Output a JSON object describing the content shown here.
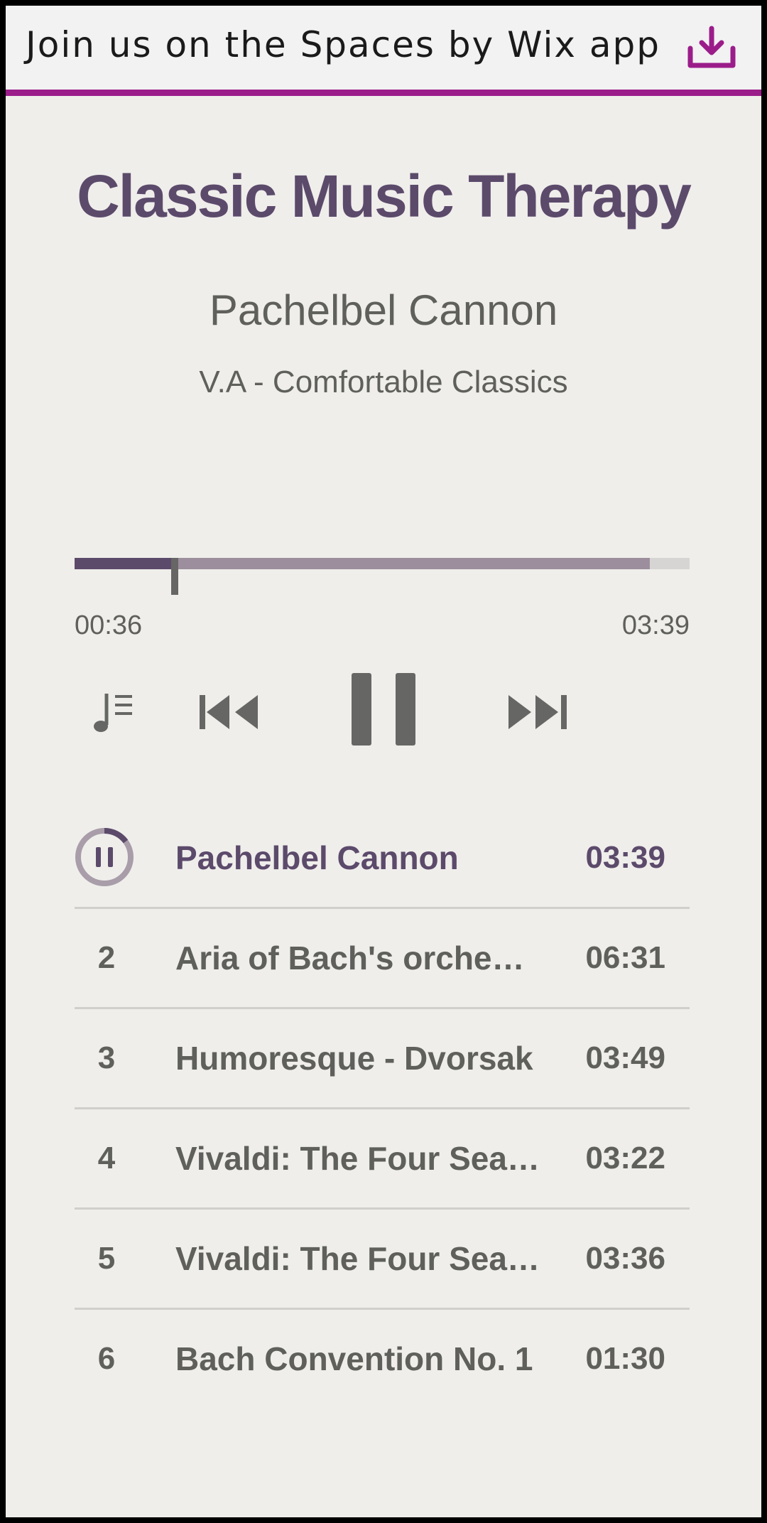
{
  "banner": {
    "text": "Join us on the Spaces by Wix app",
    "icon": "download-icon",
    "accent_color": "#9b1d8a"
  },
  "player": {
    "title": "Classic Music Therapy",
    "song": "Pachelbel Cannon",
    "artist": "V.A - Comfortable Classics",
    "progress": {
      "current_time": "00:36",
      "total_time": "03:39",
      "played_fraction": 0.164,
      "buffered_fraction": 0.935
    },
    "controls": {
      "playlist_icon": "playlist-icon",
      "previous_icon": "skip-previous-icon",
      "pause_icon": "pause-icon",
      "next_icon": "skip-next-icon"
    },
    "colors": {
      "primary": "#5c4a6b",
      "text": "#5f5f5c",
      "background": "#efeeeb"
    }
  },
  "tracks": [
    {
      "number": "1",
      "name": "Pachelbel Cannon",
      "duration": "03:39",
      "active": true,
      "status_icon": "pause-circle-icon"
    },
    {
      "number": "2",
      "name": "Aria of Bach's orche…",
      "duration": "06:31",
      "active": false
    },
    {
      "number": "3",
      "name": "Humoresque - Dvorsak",
      "duration": "03:49",
      "active": false
    },
    {
      "number": "4",
      "name": "Vivaldi: The Four Sea…",
      "duration": "03:22",
      "active": false
    },
    {
      "number": "5",
      "name": "Vivaldi: The Four Sea…",
      "duration": "03:36",
      "active": false
    },
    {
      "number": "6",
      "name": "Bach Convention No. 1",
      "duration": "01:30",
      "active": false
    }
  ]
}
